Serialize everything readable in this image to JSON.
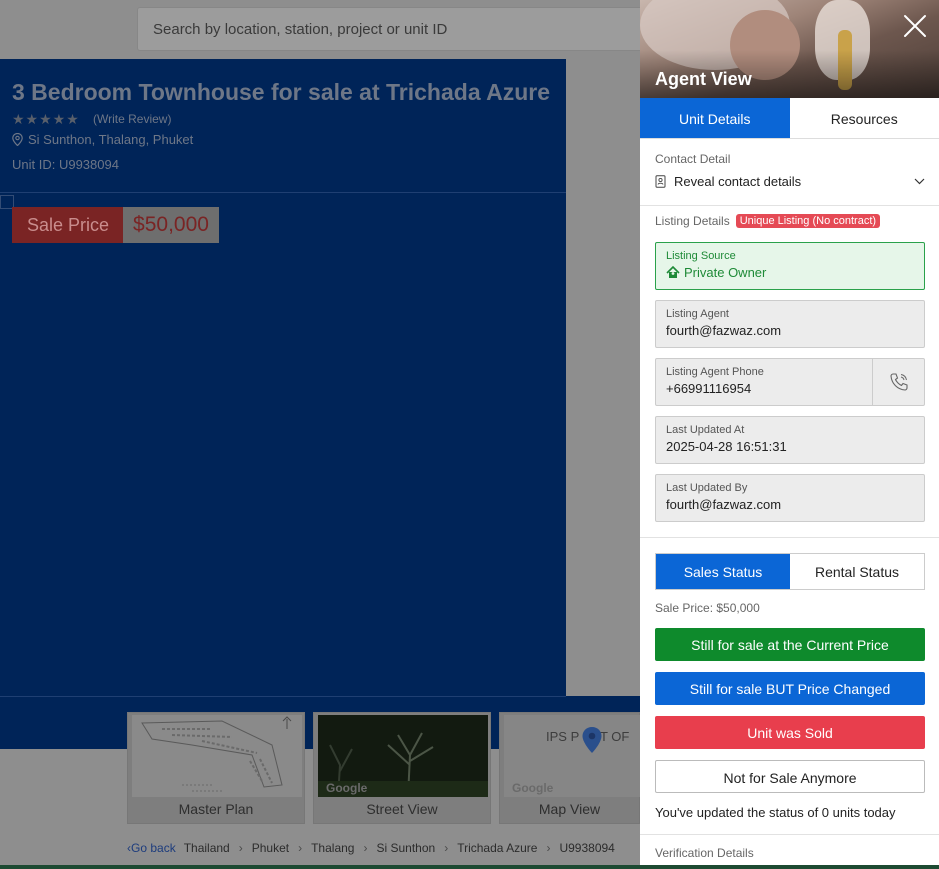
{
  "background": {
    "search_placeholder": "Search by location, station, project or unit ID",
    "listing_title": "3 Bedroom Townhouse for sale at Trichada Azure",
    "stars": "★★★★★",
    "write_review": "(Write Review)",
    "location": "Si Sunthon, Thalang, Phuket",
    "unit_id": "Unit ID: U9938094",
    "sale_price_label": "Sale Price",
    "sale_price_value": "$50,000",
    "thumbnails": [
      {
        "caption": "Master Plan"
      },
      {
        "caption": "Street View",
        "tag": "Google"
      },
      {
        "caption": "Map View",
        "tag": "Google",
        "map_text": "IPS P   KET OF"
      }
    ],
    "breadcrumb": {
      "back": "Go back",
      "items": [
        "Thailand",
        "Phuket",
        "Thalang",
        "Si Sunthon",
        "Trichada Azure",
        "U9938094"
      ]
    }
  },
  "panel": {
    "title": "Agent View",
    "tabs": [
      {
        "label": "Unit Details",
        "active": true
      },
      {
        "label": "Resources",
        "active": false
      }
    ],
    "contact": {
      "label": "Contact Detail",
      "reveal": "Reveal contact details"
    },
    "listing": {
      "label": "Listing Details",
      "badge": "Unique Listing (No contract)",
      "fields": [
        {
          "label": "Listing Source",
          "value": "Private Owner"
        },
        {
          "label": "Listing Agent",
          "value": "fourth@fazwaz.com"
        },
        {
          "label": "Listing Agent Phone",
          "value": "+66991116954"
        },
        {
          "label": "Last Updated At",
          "value": "2025-04-28 16:51:31"
        },
        {
          "label": "Last Updated By",
          "value": "fourth@fazwaz.com"
        }
      ]
    },
    "status_tabs": [
      {
        "label": "Sales Status",
        "active": true
      },
      {
        "label": "Rental Status",
        "active": false
      }
    ],
    "sale_price": "Sale Price: $50,000",
    "actions": [
      "Still for sale at the Current Price",
      "Still for sale BUT Price Changed",
      "Unit was Sold",
      "Not for Sale Anymore"
    ],
    "updated_note": "You've updated the status of 0 units today",
    "verification_label": "Verification Details"
  },
  "colors": {
    "primary_blue": "#0b66d6",
    "success_green": "#0e8a2c",
    "danger_red": "#e83e4d",
    "hero_navy": "#002458"
  }
}
